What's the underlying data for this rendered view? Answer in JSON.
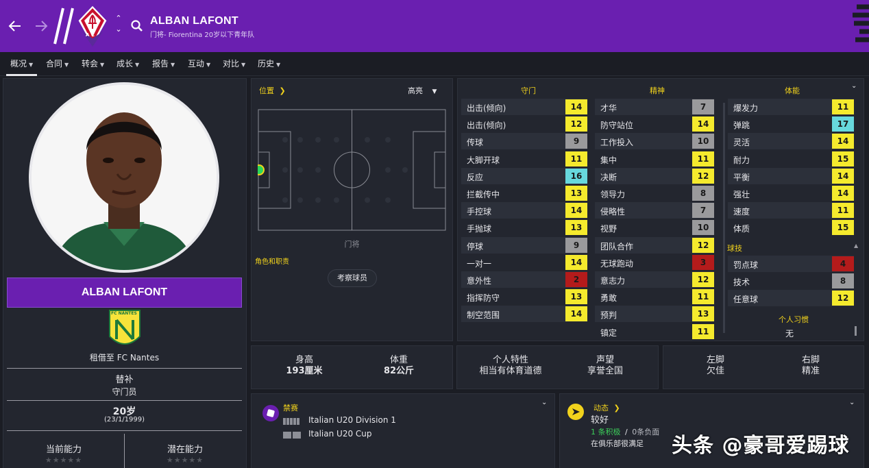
{
  "header": {
    "player_name": "ALBAN LAFONT",
    "subtitle": "门将- Fiorentina 20岁以下青年队",
    "crest_letters": "A C",
    "colors": {
      "header_bg": "#6a1fb0",
      "accent": "#f1d21c"
    }
  },
  "tabs": [
    {
      "label": "概况",
      "active": true
    },
    {
      "label": "合同"
    },
    {
      "label": "转会"
    },
    {
      "label": "成长"
    },
    {
      "label": "报告"
    },
    {
      "label": "互动"
    },
    {
      "label": "对比"
    },
    {
      "label": "历史"
    }
  ],
  "profile": {
    "name": "ALBAN LAFONT",
    "club_badge_text": "FC NANTES",
    "loan_text": "租借至 FC Nantes",
    "squad_status": "替补",
    "role": "守门员",
    "age": "20岁",
    "dob": "(23/1/1999)",
    "current_ability_label": "当前能力",
    "potential_ability_label": "潜在能力",
    "stars_glyph": "★★★★★"
  },
  "position_panel": {
    "position_link": "位置",
    "highlight_label": "高亮",
    "position_name": "门将",
    "roles_label": "角色和职责",
    "scout_button": "考察球员"
  },
  "attributes": {
    "gk_header": "守门",
    "mental_header": "精神",
    "physical_header": "体能",
    "technical_header": "球技",
    "habits_header": "个人习惯",
    "habits_value": "无",
    "goalkeeping": [
      {
        "name": "出击(倾向)",
        "value": "14",
        "level": "yellow"
      },
      {
        "name": "出击(倾向)",
        "value": "12",
        "level": "yellow"
      },
      {
        "name": "传球",
        "value": "9",
        "level": "gray"
      },
      {
        "name": "大脚开球",
        "value": "11",
        "level": "yellow"
      },
      {
        "name": "反应",
        "value": "16",
        "level": "cyan"
      },
      {
        "name": "拦截传中",
        "value": "13",
        "level": "yellow"
      },
      {
        "name": "手控球",
        "value": "14",
        "level": "yellow"
      },
      {
        "name": "手抛球",
        "value": "13",
        "level": "yellow"
      },
      {
        "name": "停球",
        "value": "9",
        "level": "gray"
      },
      {
        "name": "一对一",
        "value": "14",
        "level": "yellow"
      },
      {
        "name": "意外性",
        "value": "2",
        "level": "red"
      },
      {
        "name": "指挥防守",
        "value": "13",
        "level": "yellow"
      },
      {
        "name": "制空范围",
        "value": "14",
        "level": "yellow"
      }
    ],
    "mental": [
      {
        "name": "才华",
        "value": "7",
        "level": "gray"
      },
      {
        "name": "防守站位",
        "value": "14",
        "level": "yellow"
      },
      {
        "name": "工作投入",
        "value": "10",
        "level": "gray"
      },
      {
        "name": "集中",
        "value": "11",
        "level": "yellow"
      },
      {
        "name": "决断",
        "value": "12",
        "level": "yellow"
      },
      {
        "name": "领导力",
        "value": "8",
        "level": "gray"
      },
      {
        "name": "侵略性",
        "value": "7",
        "level": "gray"
      },
      {
        "name": "视野",
        "value": "10",
        "level": "gray"
      },
      {
        "name": "团队合作",
        "value": "12",
        "level": "yellow"
      },
      {
        "name": "无球跑动",
        "value": "3",
        "level": "red"
      },
      {
        "name": "意志力",
        "value": "12",
        "level": "yellow"
      },
      {
        "name": "勇敢",
        "value": "11",
        "level": "yellow"
      },
      {
        "name": "预判",
        "value": "13",
        "level": "yellow"
      },
      {
        "name": "镇定",
        "value": "11",
        "level": "yellow"
      }
    ],
    "physical": [
      {
        "name": "爆发力",
        "value": "11",
        "level": "yellow"
      },
      {
        "name": "弹跳",
        "value": "17",
        "level": "cyan"
      },
      {
        "name": "灵活",
        "value": "14",
        "level": "yellow"
      },
      {
        "name": "耐力",
        "value": "15",
        "level": "yellow"
      },
      {
        "name": "平衡",
        "value": "14",
        "level": "yellow"
      },
      {
        "name": "强壮",
        "value": "14",
        "level": "yellow"
      },
      {
        "name": "速度",
        "value": "11",
        "level": "yellow"
      },
      {
        "name": "体质",
        "value": "15",
        "level": "yellow"
      }
    ],
    "technical": [
      {
        "name": "罚点球",
        "value": "4",
        "level": "red"
      },
      {
        "name": "技术",
        "value": "8",
        "level": "gray"
      },
      {
        "name": "任意球",
        "value": "12",
        "level": "yellow"
      }
    ]
  },
  "info_strip": {
    "height_label": "身高",
    "height_value": "193厘米",
    "weight_label": "体重",
    "weight_value": "82公斤",
    "personality_label": "个人特性",
    "personality_value": "相当有体育道德",
    "reputation_label": "声望",
    "reputation_value": "享誉全国",
    "left_foot_label": "左脚",
    "left_foot_value": "欠佳",
    "right_foot_label": "右脚",
    "right_foot_value": "精准"
  },
  "bans": {
    "title": "禁赛",
    "items": [
      "Italian U20 Division 1",
      "Italian U20 Cup"
    ]
  },
  "dynamics": {
    "title": "动态",
    "morale": "较好",
    "positive": "1 条积极",
    "separator": "/",
    "negative": "0条负面",
    "happiness": "在俱乐部很满足"
  },
  "watermark": "头条 @豪哥爱踢球"
}
